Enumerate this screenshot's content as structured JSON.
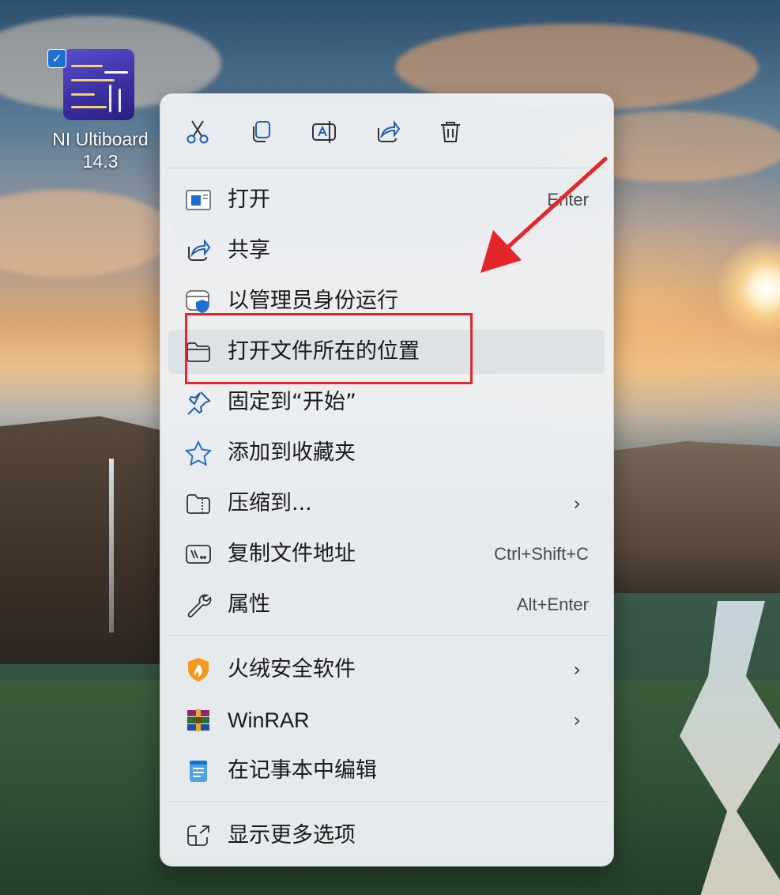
{
  "desktop_icon": {
    "label_line1": "NI Ultiboard",
    "label_line2": "14.3",
    "selected_check": "✓",
    "icon": "ni-ultiboard-app-icon"
  },
  "context_menu": {
    "toolbar": [
      {
        "name": "cut",
        "icon": "scissors-icon"
      },
      {
        "name": "copy",
        "icon": "copy-icon"
      },
      {
        "name": "rename",
        "icon": "rename-icon"
      },
      {
        "name": "share",
        "icon": "share-icon"
      },
      {
        "name": "delete",
        "icon": "trash-icon"
      }
    ],
    "items": [
      {
        "label": "打开",
        "shortcut": "Enter",
        "icon": "open-window-icon"
      },
      {
        "label": "共享",
        "icon": "share-icon"
      },
      {
        "label": "以管理员身份运行",
        "icon": "shield-window-icon"
      },
      {
        "label": "打开文件所在的位置",
        "icon": "folder-icon",
        "highlighted": true
      },
      {
        "label": "固定到“开始”",
        "icon": "pin-icon"
      },
      {
        "label": "添加到收藏夹",
        "icon": "star-icon"
      },
      {
        "label": "压缩到...",
        "icon": "zip-folder-icon",
        "submenu": "›"
      },
      {
        "label": "复制文件地址",
        "shortcut": "Ctrl+Shift+C",
        "icon": "copy-path-icon"
      },
      {
        "label": "属性",
        "shortcut": "Alt+Enter",
        "icon": "wrench-icon"
      },
      {
        "label": "火绒安全软件",
        "icon": "huorong-shield-icon",
        "submenu": "›"
      },
      {
        "label": "WinRAR",
        "icon": "winrar-icon",
        "submenu": "›"
      },
      {
        "label": "在记事本中编辑",
        "icon": "notepad-icon"
      },
      {
        "label": "显示更多选项",
        "icon": "more-options-icon"
      }
    ]
  },
  "annotation": {
    "box_color": "#e4262b",
    "arrow_color": "#e4262b"
  },
  "colors": {
    "accent": "#1f6fd1",
    "menu_bg": "#edf0f4"
  }
}
